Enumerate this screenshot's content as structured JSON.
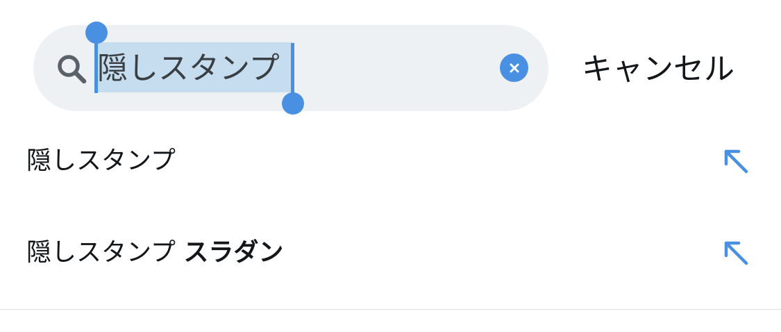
{
  "search": {
    "query": "隠しスタンプ",
    "cancel_label": "キャンセル"
  },
  "suggestions": [
    {
      "text": "隠しスタンプ",
      "bold_suffix": ""
    },
    {
      "text": "隠しスタンプ ",
      "bold_suffix": "スラダン"
    }
  ],
  "colors": {
    "accent": "#4a90e2",
    "search_bg": "#edf1f3",
    "selection": "#c6ddf0"
  },
  "icons": {
    "search": "search-icon",
    "clear": "clear-icon",
    "fill_suggestion": "arrow-up-left-icon"
  }
}
